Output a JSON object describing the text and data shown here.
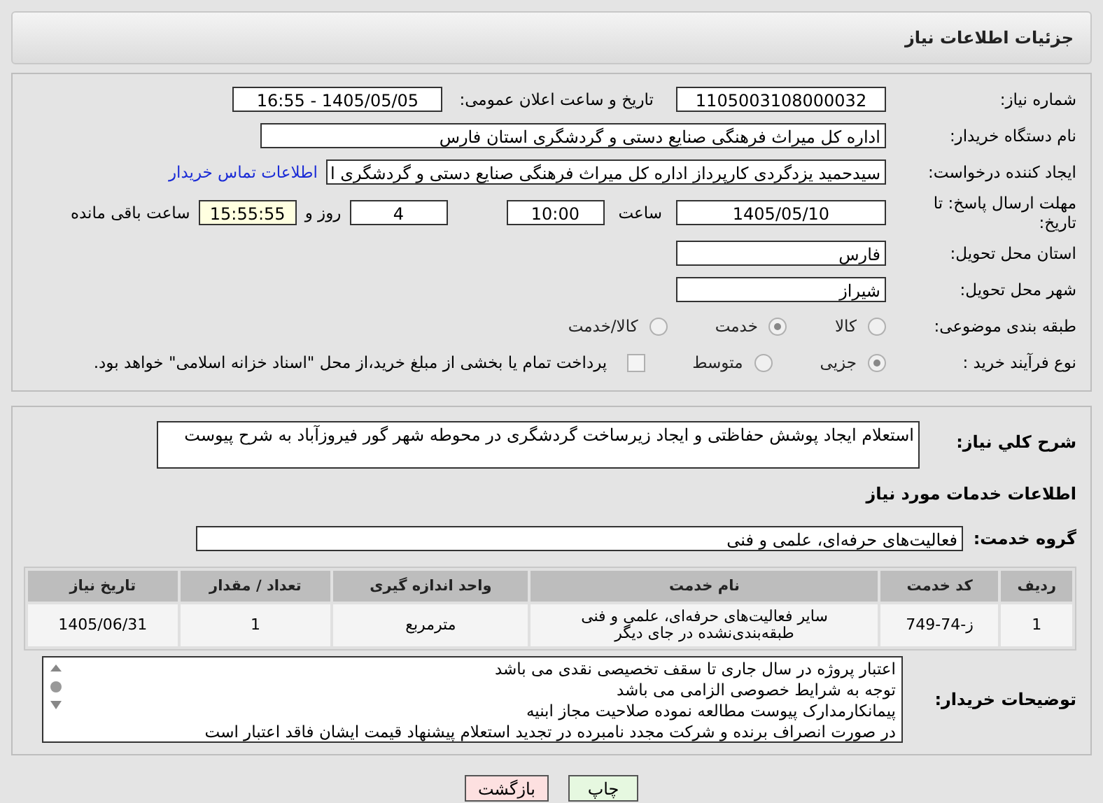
{
  "header": {
    "title": "جزئیات اطلاعات نیاز"
  },
  "need_number": {
    "label": "شماره نیاز:",
    "value": "1105003108000032"
  },
  "announce": {
    "label": "تاریخ و ساعت اعلان عمومی:",
    "value": "1405/05/05 - 16:55"
  },
  "buyer": {
    "label": "نام دستگاه خریدار:",
    "value": "اداره کل میراث فرهنگی  صنایع دستی و گردشگری استان فارس"
  },
  "creator": {
    "label": "ایجاد کننده درخواست:",
    "value": "سیدحمید یزدگردی کارپرداز اداره کل میراث فرهنگی  صنایع دستی و گردشگری ا",
    "link": "اطلاعات تماس خریدار"
  },
  "deadline": {
    "label": "مهلت ارسال پاسخ: تا تاریخ:",
    "date": "1405/05/10",
    "time_label": "ساعت",
    "time": "10:00",
    "days": "4",
    "days_label": "روز و",
    "remaining": "15:55:55",
    "remaining_label": "ساعت باقی مانده"
  },
  "province": {
    "label": "استان محل تحویل:",
    "value": "فارس"
  },
  "city": {
    "label": "شهر محل تحویل:",
    "value": "شیراز"
  },
  "category": {
    "label": "طبقه بندی موضوعی:",
    "options": [
      {
        "label": "کالا",
        "selected": false
      },
      {
        "label": "خدمت",
        "selected": true
      },
      {
        "label": "کالا/خدمت",
        "selected": false
      }
    ]
  },
  "process": {
    "label": "نوع فرآیند خرید :",
    "options": [
      {
        "label": "جزیی",
        "selected": true
      },
      {
        "label": "متوسط",
        "selected": false
      }
    ],
    "payment": {
      "label": "پرداخت تمام یا بخشی از مبلغ خرید،از محل \"اسناد خزانه اسلامی\" خواهد بود.",
      "checked": false
    }
  },
  "description": {
    "label": "شرح کلي نياز:",
    "value": "استعلام ایجاد پوشش حفاظتی و ایجاد زیرساخت گردشگری در محوطه شهر گور فیروزآباد به شرح پیوست"
  },
  "services_heading": "اطلاعات خدمات مورد نیاز",
  "service_group": {
    "label": "گروه خدمت:",
    "value": "فعالیت‌های حرفه‌ای، علمی و فنی"
  },
  "table": {
    "columns": [
      "ردیف",
      "کد خدمت",
      "نام خدمت",
      "واحد اندازه گیری",
      "تعداد / مقدار",
      "تاریخ نیاز"
    ],
    "rows": [
      [
        "1",
        "ز-74-749",
        "سایر فعالیت‌های حرفه‌ای، علمی و فنی طبقه‌بندی‌نشده در جای دیگر",
        "مترمربع",
        "1",
        "1405/06/31"
      ]
    ]
  },
  "buyer_notes": {
    "label": "توضیحات خریدار:",
    "lines": [
      "اعتبار پروژه در سال جاری تا سقف تخصیصی نقدی می باشد",
      "توجه به شرایط خصوصی الزامی می باشد",
      "پیمانکارمدارک پیوست مطالعه نموده صلاحیت مجاز ابنیه",
      "در صورت انصراف برنده و شرکت مجدد نامبرده در تجدید استعلام  پیشنهاد قیمت ایشان فاقد اعتبار است"
    ]
  },
  "buttons": [
    {
      "label": "چاپ",
      "kind": "print"
    },
    {
      "label": "بازگشت",
      "kind": "back"
    }
  ]
}
